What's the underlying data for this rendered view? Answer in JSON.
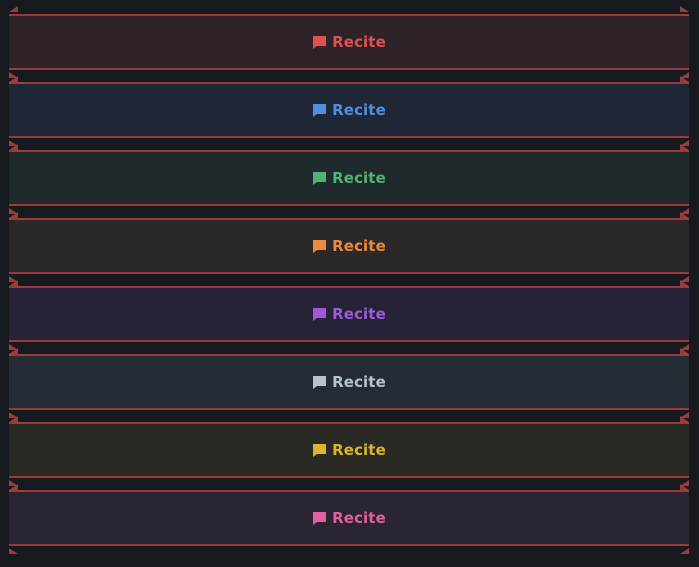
{
  "buttons": [
    {
      "label": "Recite",
      "icon": "speech-bubble-icon",
      "text_color": "#e05151",
      "bg": "#2d2328"
    },
    {
      "label": "Recite",
      "icon": "speech-bubble-icon",
      "text_color": "#4f8fdf",
      "bg": "#1f2736"
    },
    {
      "label": "Recite",
      "icon": "speech-bubble-icon",
      "text_color": "#4fb373",
      "bg": "#1f2a2c"
    },
    {
      "label": "Recite",
      "icon": "speech-bubble-icon",
      "text_color": "#e98a3f",
      "bg": "#2d2828"
    },
    {
      "label": "Recite",
      "icon": "speech-bubble-icon",
      "text_color": "#a05ad9",
      "bg": "#262336"
    },
    {
      "label": "Recite",
      "icon": "speech-bubble-icon",
      "text_color": "#b7c3cc",
      "bg": "#262c33"
    },
    {
      "label": "Recite",
      "icon": "speech-bubble-icon",
      "text_color": "#d9b72a",
      "bg": "#2a2a25"
    },
    {
      "label": "Recite",
      "icon": "speech-bubble-icon",
      "text_color": "#e55fa0",
      "bg": "#2b2431"
    }
  ],
  "accent_border": "#9c3b3b"
}
